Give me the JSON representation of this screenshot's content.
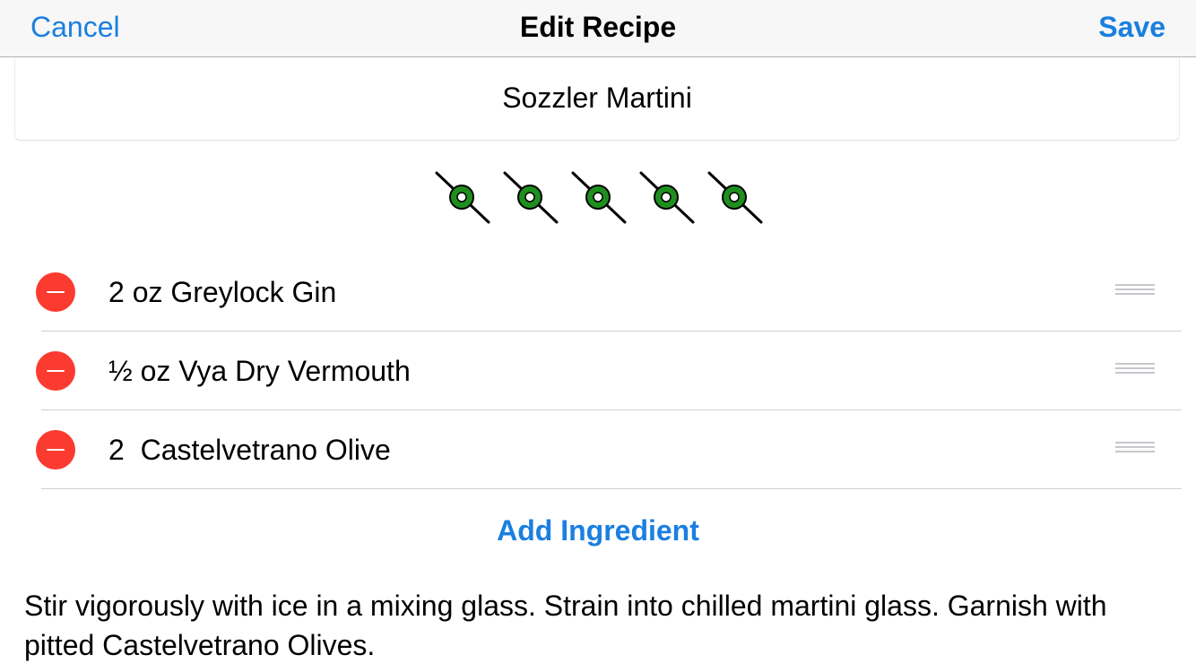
{
  "navbar": {
    "cancel_label": "Cancel",
    "title": "Edit Recipe",
    "save_label": "Save"
  },
  "recipe": {
    "name": "Sozzler Martini",
    "rating": 5,
    "rating_max": 5,
    "rating_icon": "olive-on-pick-icon",
    "ingredients": [
      {
        "text": "2 oz Greylock Gin"
      },
      {
        "text": "½ oz Vya Dry Vermouth"
      },
      {
        "text": "2  Castelvetrano Olive"
      }
    ],
    "add_ingredient_label": "Add Ingredient",
    "instructions": "Stir vigorously with ice in a mixing glass. Strain into chilled martini glass. Garnish with pitted Castelvetrano Olives."
  },
  "colors": {
    "accent": "#1a7fe0",
    "delete": "#fb3b30",
    "olive": "#1e8f1e"
  }
}
